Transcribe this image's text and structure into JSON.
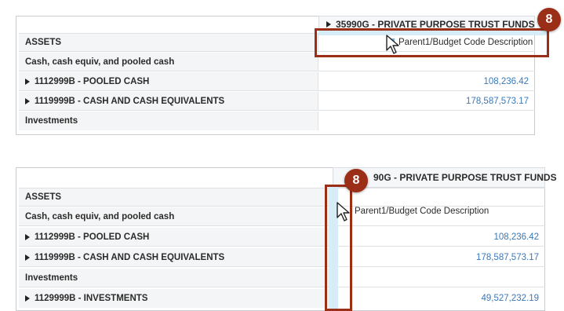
{
  "step_number": "8",
  "panel_top": {
    "column_header": "35990G - PRIVATE PURPOSE TRUST FUNDS",
    "drag_tip": "Parent1/Budget Code Description",
    "rows": [
      {
        "label": "ASSETS",
        "value": ""
      },
      {
        "label": "Cash, cash equiv, and pooled cash",
        "value": ""
      },
      {
        "label": "1112999B - POOLED CASH",
        "value": "108,236.42"
      },
      {
        "label": "1119999B - CASH AND CASH EQUIVALENTS",
        "value": "178,587,573.17"
      },
      {
        "label": "Investments",
        "value": ""
      }
    ]
  },
  "panel_bottom": {
    "column_header": "90G - PRIVATE PURPOSE TRUST FUNDS",
    "drag_tip": "Parent1/Budget Code Description",
    "rows": [
      {
        "label": "ASSETS",
        "value": ""
      },
      {
        "label": "Cash, cash equiv, and pooled cash",
        "value": ""
      },
      {
        "label": "1112999B - POOLED CASH",
        "value": "108,236.42"
      },
      {
        "label": "1119999B - CASH AND CASH EQUIVALENTS",
        "value": "178,587,573.17"
      },
      {
        "label": "Investments",
        "value": ""
      },
      {
        "label": "1129999B - INVESTMENTS",
        "value": "49,527,232.19"
      }
    ]
  },
  "colors": {
    "accent": "#9b2e17",
    "value_link": "#3a78b8",
    "drop_zone": "#d6ecf7"
  }
}
